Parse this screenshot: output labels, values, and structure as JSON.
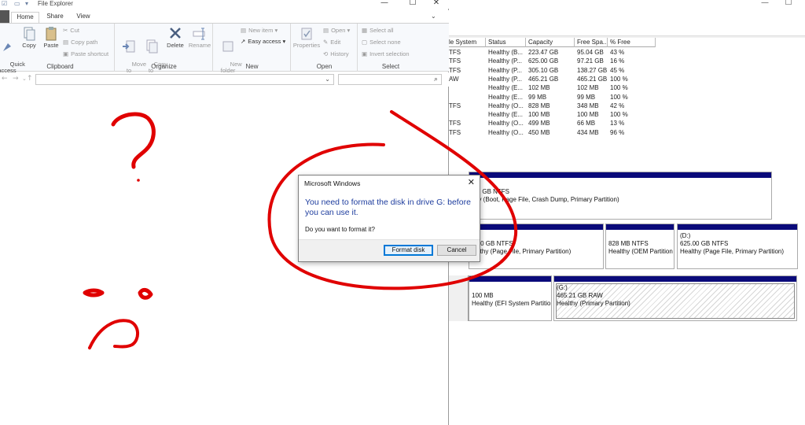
{
  "disk_management": {
    "columns": [
      "le System",
      "Status",
      "Capacity",
      "Free Spa...",
      "% Free"
    ],
    "rows": [
      {
        "fs": "TFS",
        "status": "Healthy (B...",
        "capacity": "223.47 GB",
        "free": "95.04 GB",
        "pct": "43 %"
      },
      {
        "fs": "TFS",
        "status": "Healthy (P...",
        "capacity": "625.00 GB",
        "free": "97.21 GB",
        "pct": "16 %"
      },
      {
        "fs": "TFS",
        "status": "Healthy (P...",
        "capacity": "305.10 GB",
        "free": "138.27 GB",
        "pct": "45 %"
      },
      {
        "fs": "AW",
        "status": "Healthy (P...",
        "capacity": "465.21 GB",
        "free": "465.21 GB",
        "pct": "100 %"
      },
      {
        "fs": "",
        "status": "Healthy (E...",
        "capacity": "102 MB",
        "free": "102 MB",
        "pct": "100 %"
      },
      {
        "fs": "",
        "status": "Healthy (E...",
        "capacity": "99 MB",
        "free": "99 MB",
        "pct": "100 %"
      },
      {
        "fs": "TFS",
        "status": "Healthy (O...",
        "capacity": "828 MB",
        "free": "348 MB",
        "pct": "42 %"
      },
      {
        "fs": "",
        "status": "Healthy (E...",
        "capacity": "100 MB",
        "free": "100 MB",
        "pct": "100 %"
      },
      {
        "fs": "TFS",
        "status": "Healthy (O...",
        "capacity": "499 MB",
        "free": "66 MB",
        "pct": "13 %"
      },
      {
        "fs": "TFS",
        "status": "Healthy (O...",
        "capacity": "450 MB",
        "free": "434 MB",
        "pct": "96 %"
      }
    ],
    "graph": {
      "disk0_part1": {
        "line1": ":)",
        "line2": ".47 GB NTFS",
        "line3": "lthy (Boot, Page File, Crash Dump, Primary Partition)"
      },
      "disk1_part1": {
        "line1": "E:)",
        "line2": "5.10 GB NTFS",
        "line3": "ealthy (Page File, Primary Partition)"
      },
      "disk1_part2": {
        "line1": "828 MB NTFS",
        "line2": "Healthy (OEM Partition"
      },
      "disk1_part3": {
        "line1": "(D:)",
        "line2": "625.00 GB NTFS",
        "line3": "Healthy (Page File, Primary Partition)"
      },
      "disk2_part1": {
        "line1": "100 MB",
        "line2": "Healthy (EFI System Partition"
      },
      "disk2_part2": {
        "line1": "(G:)",
        "line2": "465.21 GB RAW",
        "line3": "Healthy (Primary Partition)"
      }
    }
  },
  "file_explorer": {
    "title": "File Explorer",
    "tabs": [
      "Home",
      "Share",
      "View"
    ],
    "ribbon": {
      "clipboard": {
        "label": "Clipboard",
        "quick_access": "Quick\naccess",
        "copy": "Copy",
        "paste": "Paste",
        "cut": "Cut",
        "copy_path": "Copy path",
        "paste_shortcut": "Paste shortcut"
      },
      "organize": {
        "label": "Organize",
        "move_to": "Move\nto",
        "copy_to": "Copy\nto",
        "delete": "Delete",
        "rename": "Rename"
      },
      "new": {
        "label": "New",
        "new_folder": "New\nfolder",
        "new_item": "New item",
        "easy_access": "Easy access"
      },
      "open": {
        "label": "Open",
        "properties": "Properties",
        "open": "Open",
        "edit": "Edit",
        "history": "History"
      },
      "select": {
        "label": "Select",
        "select_all": "Select all",
        "select_none": "Select none",
        "invert": "Invert selection"
      }
    }
  },
  "dialog": {
    "title": "Microsoft Windows",
    "message": "You need to format the disk in drive G: before you can use it.",
    "question": "Do you want to format it?",
    "format_button": "Format disk",
    "cancel_button": "Cancel"
  },
  "colors": {
    "dialog_message": "#1e3d9e",
    "partition_bar": "#0a0a7a",
    "annotation": "#e00000"
  }
}
